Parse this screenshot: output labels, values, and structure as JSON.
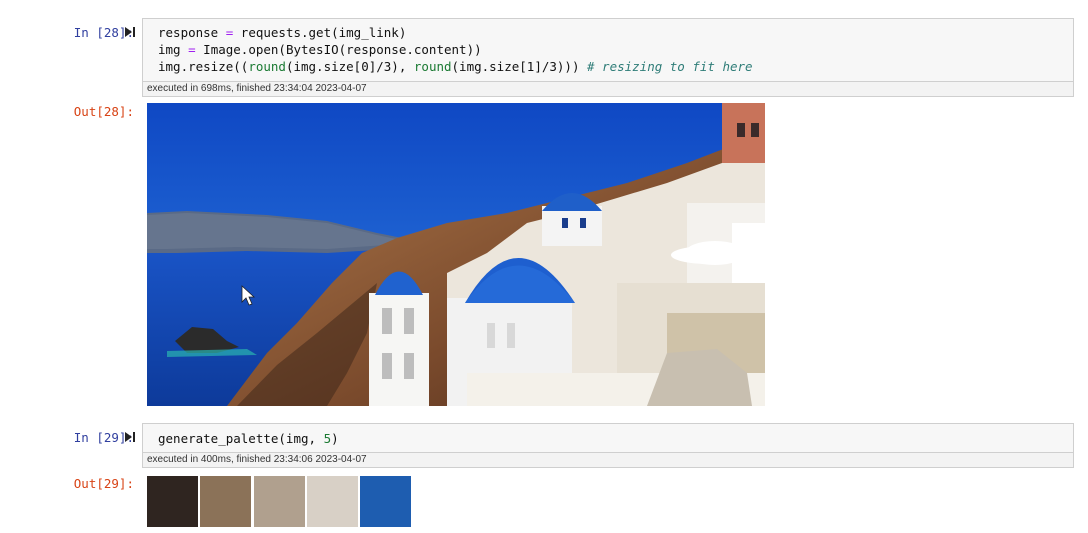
{
  "cells": {
    "c28": {
      "in_prompt": "In [28]:",
      "out_prompt": "Out[28]:",
      "code": {
        "line1": {
          "a": "response ",
          "b": "=",
          "c": " requests.get(img_link)"
        },
        "line2": {
          "a": "img ",
          "b": "=",
          "c": " Image.open(BytesIO(response.content))"
        },
        "line3": {
          "a": "img.resize((",
          "b": "round",
          "c": "(img.size[0]/3), ",
          "d": "round",
          "e": "(img.size[1]/3))) ",
          "f": "# resizing to fit here"
        }
      },
      "exec_info": "executed in 698ms, finished 23:34:04 2023-04-07",
      "output_image": "image-output"
    },
    "c29": {
      "in_prompt": "In [29]:",
      "out_prompt": "Out[29]:",
      "code": {
        "a": "generate_palette(img, ",
        "b": "5",
        "c": ")"
      },
      "exec_info": "executed in 400ms, finished 23:34:06 2023-04-07",
      "palette": [
        "#2f2520",
        "#8b7258",
        "#b0a08e",
        "#d8d0c6",
        "#1e5db0"
      ]
    }
  },
  "icons": {
    "run": "run-cell-icon",
    "cursor": "mouse-pointer-icon"
  },
  "colors": {
    "in_prompt": "#303f9f",
    "out_prompt": "#d84315"
  }
}
